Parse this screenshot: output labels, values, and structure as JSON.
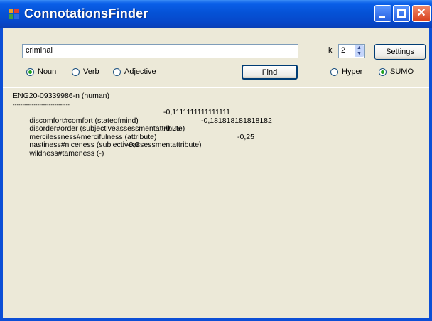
{
  "window": {
    "title": "ConnotationsFinder"
  },
  "search": {
    "value": "criminal"
  },
  "k": {
    "label": "k",
    "value": "2"
  },
  "buttons": {
    "settings": "Settings",
    "find": "Find"
  },
  "pos_options": [
    {
      "label": "Noun",
      "selected": true
    },
    {
      "label": "Verb",
      "selected": false
    },
    {
      "label": "Adjective",
      "selected": false
    }
  ],
  "mode_options": [
    {
      "label": "Hyper",
      "selected": false
    },
    {
      "label": "SUMO",
      "selected": true
    }
  ],
  "results": {
    "header": "ENG20-09339986-n (human)",
    "separator": "------------------------------",
    "rows": [
      {
        "term": "discomfort#comfort (stateofmind)",
        "score": "-0,1111111111111111"
      },
      {
        "term": "disorder#order (subjectiveassessmentattribute)",
        "score": "-0,181818181818182"
      },
      {
        "term": "mercilessness#mercifulness (attribute)",
        "score": "-0,25"
      },
      {
        "term": "nastiness#niceness (subjectiveassessmentattribute)",
        "score": "-0,25"
      },
      {
        "term": "wildness#tameness (-)",
        "score": "-0,2"
      }
    ]
  }
}
